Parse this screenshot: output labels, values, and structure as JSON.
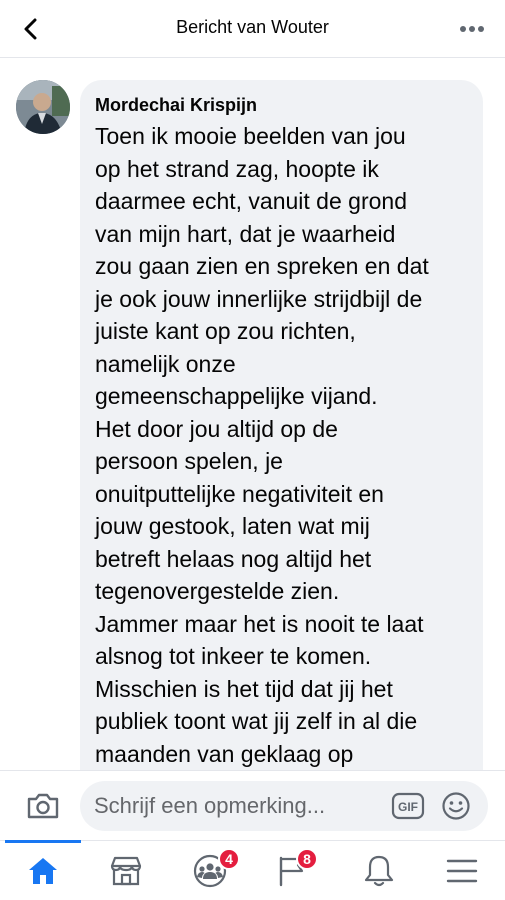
{
  "header": {
    "title": "Bericht van Wouter",
    "back_icon": "chevron-left-icon",
    "more_icon": "more-horizontal-icon"
  },
  "comment": {
    "author": "Mordechai Krispijn",
    "lines": [
      "Toen ik mooie beelden van jou",
      "op het strand zag, hoopte ik",
      "daarmee echt, vanuit de grond",
      "van mijn hart, dat je waarheid",
      "zou gaan zien en spreken en dat",
      "je ook jouw innerlijke strijdbijl de",
      "juiste kant op zou richten,",
      "namelijk onze",
      "gemeenschappelijke vijand.",
      "Het door jou altijd op de",
      "persoon spelen, je",
      "onuitputtelijke negativiteit en",
      "jouw gestook, laten wat mij",
      "betreft helaas nog altijd het",
      "tegenovergestelde zien.",
      "Jammer maar het is nooit te laat",
      "alsnog tot inkeer te komen.",
      "Misschien is het tijd dat jij het",
      "publiek toont wat jij zelf in al die",
      "maanden van geklaag op"
    ]
  },
  "composer": {
    "placeholder": "Schrijf een opmerking...",
    "value": "",
    "gif_label": "GIF",
    "camera_icon": "camera-icon",
    "emoji_icon": "emoji-icon"
  },
  "tabbar": {
    "tabs": [
      {
        "name": "home",
        "icon": "home-icon",
        "active": true
      },
      {
        "name": "marketplace",
        "icon": "marketplace-icon",
        "active": false
      },
      {
        "name": "groups",
        "icon": "groups-icon",
        "active": false,
        "badge": "4"
      },
      {
        "name": "pages",
        "icon": "pages-flag-icon",
        "active": false,
        "badge": "8"
      },
      {
        "name": "notifications",
        "icon": "bell-icon",
        "active": false
      },
      {
        "name": "menu",
        "icon": "hamburger-menu-icon",
        "active": false
      }
    ]
  },
  "colors": {
    "accent": "#1877f2",
    "badge": "#e41e3f",
    "bubble": "#f0f2f5",
    "text": "#050505",
    "secondary_text": "#65676b"
  }
}
